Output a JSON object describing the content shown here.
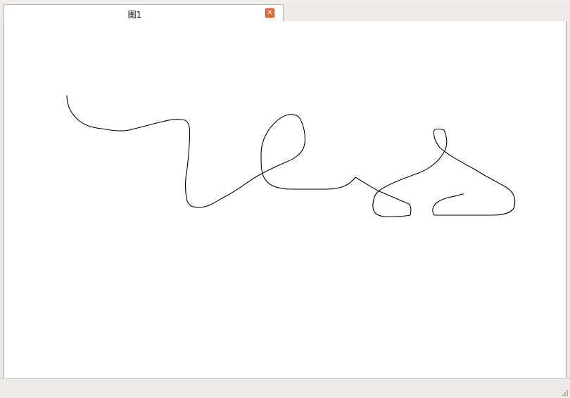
{
  "tabs": [
    {
      "title": "图1",
      "active": true,
      "close_icon": "close-icon"
    }
  ],
  "canvas": {
    "background": "#ffffff",
    "stroke_color": "#000000"
  },
  "colors": {
    "close_button": "#e8683a",
    "chrome": "#ece9e6"
  }
}
